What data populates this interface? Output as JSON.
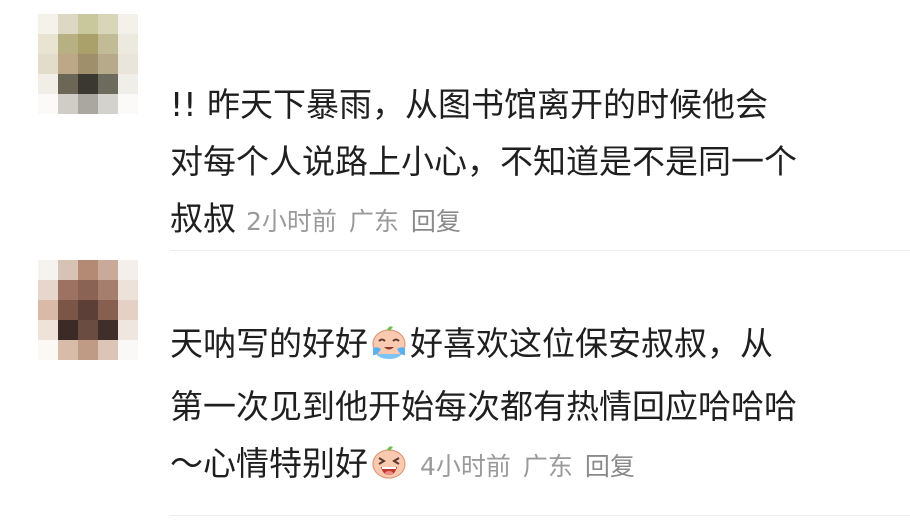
{
  "comments": [
    {
      "text_lines": [
        "!! 昨天下暴雨，从图书馆离开的时候他会",
        "对每个人说路上小心，不知道是不是同一个",
        "叔叔"
      ],
      "time": "2小时前",
      "location": "广东",
      "reply_label": "回复",
      "avatar_icon": "pixelated-avatar-icon"
    },
    {
      "text_line1_a": "天呐写的好好",
      "text_line1_b": "好喜欢这位保安叔叔，从",
      "text_line2": "第一次见到他开始每次都有热情回应哈哈哈",
      "text_line3": "～心情特别好",
      "time": "4小时前",
      "location": "广东",
      "reply_label": "回复",
      "emoji_1": "crying-face-emoji-icon",
      "emoji_2": "laughing-face-emoji-icon",
      "avatar_icon": "pixelated-avatar-icon"
    }
  ]
}
